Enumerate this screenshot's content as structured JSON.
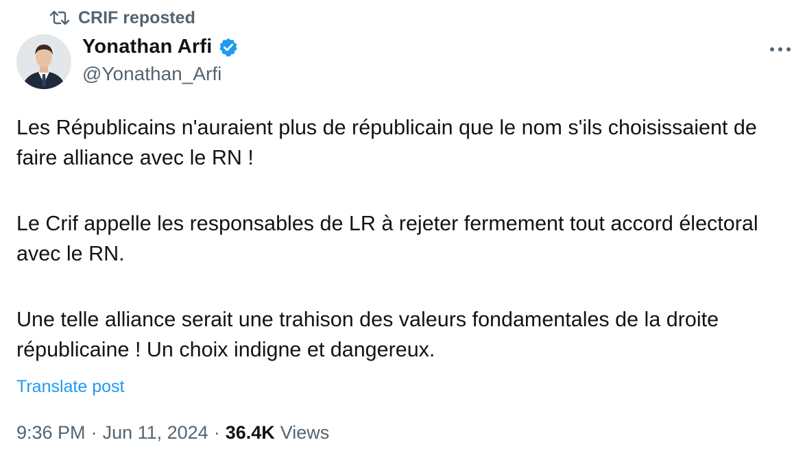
{
  "repost": {
    "label": "CRIF reposted",
    "icon": "repost-icon"
  },
  "author": {
    "display_name": "Yonathan Arfi",
    "handle": "@Yonathan_Arfi",
    "verified": true,
    "verified_color": "#1d9bf0",
    "avatar_icon": "avatar-photo"
  },
  "menu": {
    "icon": "more-options-icon"
  },
  "tweet": {
    "paragraphs": [
      "Les Républicains n'auraient plus de républicain que le nom s'ils choisissaient de faire alliance avec le RN !",
      "Le Crif appelle les responsables de LR à rejeter fermement tout accord électoral avec le RN.",
      "Une telle alliance serait une trahison des valeurs fondamentales de la droite républicaine ! Un choix indigne et dangereux."
    ],
    "translate_label": "Translate post"
  },
  "meta": {
    "time": "9:36 PM",
    "separator": "·",
    "date": "Jun 11, 2024",
    "views_count": "36.4K",
    "views_label": "Views"
  },
  "colors": {
    "text_primary": "#0f1419",
    "text_secondary": "#536471",
    "link": "#1d9bf0"
  }
}
